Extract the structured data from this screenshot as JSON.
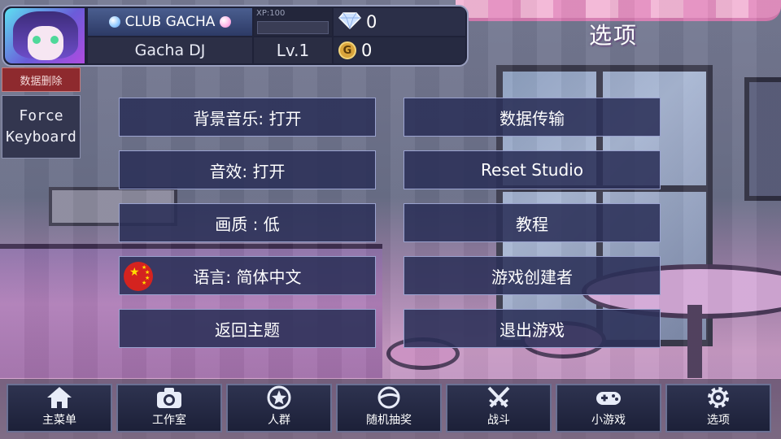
{
  "header": {
    "club_label": "CLUB GACHA",
    "player_name": "Gacha DJ",
    "xp_label": "XP:100",
    "xp_progress": 0,
    "level": "Lv.1",
    "gems": "0",
    "gold": "0",
    "gold_coin_letter": "G"
  },
  "page_title": "选项",
  "utility": {
    "delete_data": "数据删除",
    "force_keyboard": "Force\nKeyboard"
  },
  "options": {
    "bgm": "背景音乐: 打开",
    "sfx": "音效: 打开",
    "quality": "画质 : 低",
    "language": "语言: 简体中文",
    "back_to_title": "返回主题",
    "data_transfer": "数据传输",
    "reset_studio": "Reset Studio",
    "tutorial": "教程",
    "credits": "游戏创建者",
    "quit": "退出游戏"
  },
  "nav": {
    "items": [
      {
        "label": "主菜单",
        "icon": "home-icon"
      },
      {
        "label": "工作室",
        "icon": "camera-icon"
      },
      {
        "label": "人群",
        "icon": "star-icon"
      },
      {
        "label": "随机抽奖",
        "icon": "capsule-icon"
      },
      {
        "label": "战斗",
        "icon": "crossed-swords-icon"
      },
      {
        "label": "小游戏",
        "icon": "gamepad-icon"
      },
      {
        "label": "选项",
        "icon": "gear-icon"
      }
    ]
  },
  "colors": {
    "button_bg": "#2b3058",
    "button_border": "#9aa2cf",
    "delete_red": "#8e2a2e",
    "coin_gold": "#d9a43b"
  }
}
